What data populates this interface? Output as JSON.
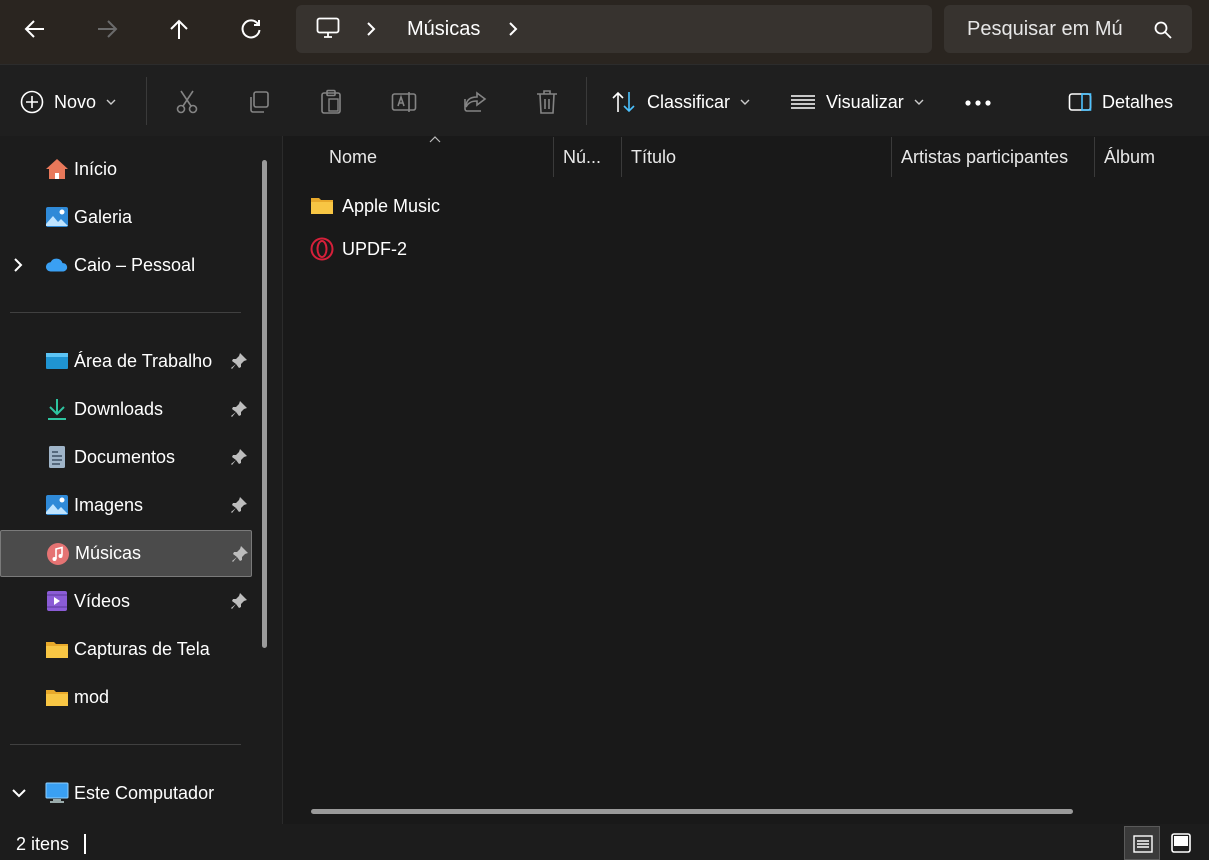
{
  "address": {
    "breadcrumb": [
      "Músicas"
    ],
    "search_placeholder": "Pesquisar em Mú"
  },
  "toolbar": {
    "new_label": "Novo",
    "sort_label": "Classificar",
    "view_label": "Visualizar",
    "details_label": "Detalhes"
  },
  "sidebar": {
    "top_items": [
      {
        "label": "Início",
        "icon": "home-icon"
      },
      {
        "label": "Galeria",
        "icon": "gallery-icon"
      },
      {
        "label": "Caio – Pessoal",
        "icon": "onedrive-cloud-icon"
      }
    ],
    "quick_access": [
      {
        "label": "Área de Trabalho",
        "icon": "desktop-icon",
        "pinned": true
      },
      {
        "label": "Downloads",
        "icon": "download-icon",
        "pinned": true
      },
      {
        "label": "Documentos",
        "icon": "document-icon",
        "pinned": true
      },
      {
        "label": "Imagens",
        "icon": "pictures-icon",
        "pinned": true
      },
      {
        "label": "Músicas",
        "icon": "music-icon",
        "pinned": true,
        "selected": true
      },
      {
        "label": "Vídeos",
        "icon": "video-icon",
        "pinned": true
      },
      {
        "label": "Capturas de Tela",
        "icon": "folder-icon",
        "pinned": false
      },
      {
        "label": "mod",
        "icon": "folder-icon",
        "pinned": false
      }
    ],
    "this_pc": {
      "label": "Este Computador",
      "icon": "monitor-icon"
    }
  },
  "columns": [
    "Nome",
    "Nú...",
    "Título",
    "Artistas participantes",
    "Álbum"
  ],
  "files": [
    {
      "name": "Apple Music",
      "icon": "folder-icon"
    },
    {
      "name": "UPDF-2",
      "icon": "opera-icon"
    }
  ],
  "status": {
    "item_count": "2 itens"
  },
  "colors": {
    "accent": "#4cc2ff",
    "selected_bg": "#4b4b4b",
    "folder": "#f8c644"
  }
}
